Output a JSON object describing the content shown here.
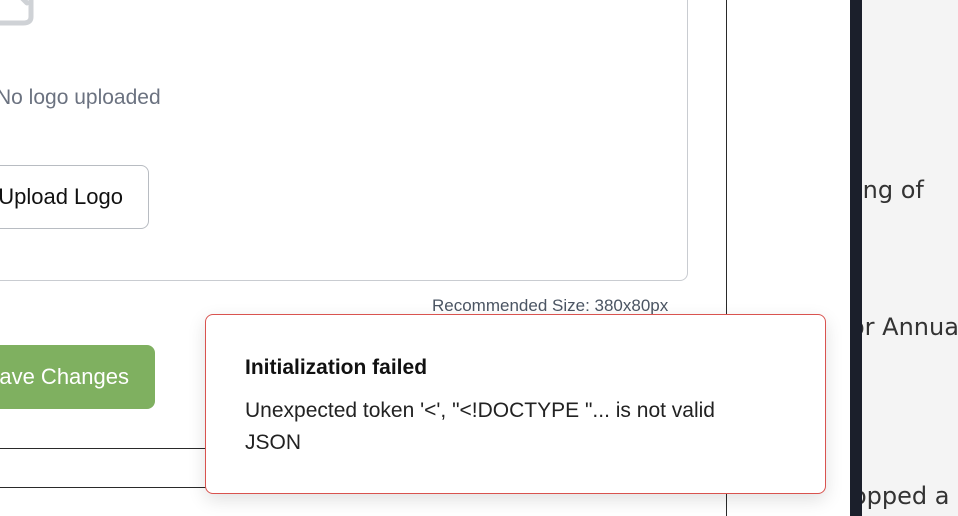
{
  "logo_section": {
    "empty_text": "No logo uploaded",
    "upload_button_label": "Upload Logo",
    "recommended_size": "Recommended Size: 380x80px"
  },
  "actions": {
    "save_label": "Save Changes"
  },
  "side_panel": {
    "lines": [
      "ing of",
      "or Annua",
      "opped a"
    ]
  },
  "toast": {
    "title": "Initialization failed",
    "message": "Unexpected token '<', \"<!DOCTYPE \"... is not valid JSON",
    "border_color": "#d9534f"
  },
  "colors": {
    "save_button": "#7fb060",
    "dark_strip": "#1b1f2b"
  },
  "icons": {
    "logo_placeholder": "image-placeholder-icon"
  }
}
